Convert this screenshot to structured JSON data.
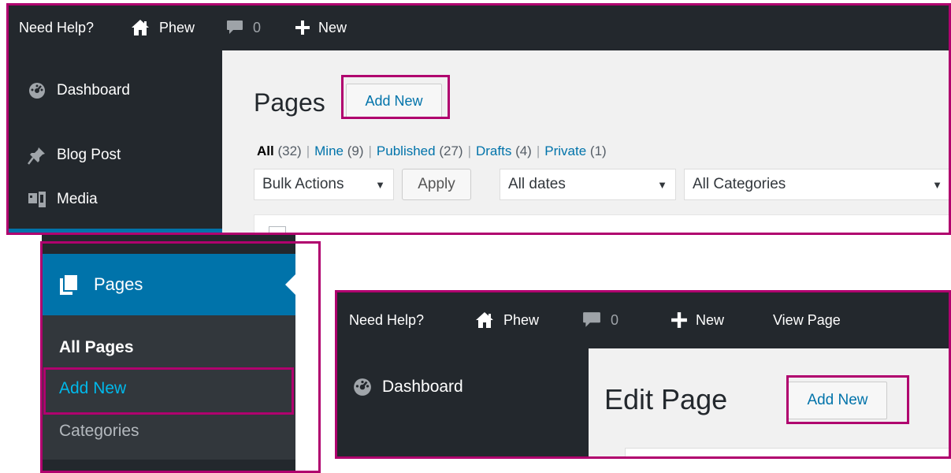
{
  "colors": {
    "admin_bar": "#23282d",
    "admin_menu": "#23282d",
    "submenu": "#32373c",
    "accent_blue": "#0073aa",
    "content_bg": "#f1f1f1",
    "highlight": "#b0006e"
  },
  "panel1": {
    "admin_bar": {
      "help": "Need Help?",
      "site": "Phew",
      "site_icon": "home-icon",
      "comments_count": "0",
      "comments_icon": "comment-bubble-icon",
      "new": "New",
      "new_icon": "plus-icon"
    },
    "sidebar": [
      {
        "label": "Dashboard",
        "icon": "dashboard-gauge-icon"
      },
      {
        "label": "Blog Post",
        "icon": "pushpin-icon"
      },
      {
        "label": "Media",
        "icon": "media-icon"
      }
    ],
    "title": "Pages",
    "add_new": "Add New",
    "filters": {
      "all": "All",
      "all_count": "(32)",
      "mine": "Mine",
      "mine_count": "(9)",
      "published": "Published",
      "published_count": "(27)",
      "drafts": "Drafts",
      "drafts_count": "(4)",
      "private": "Private",
      "private_count": "(1)"
    },
    "bulk_actions": "Bulk Actions",
    "apply": "Apply",
    "dates": "All dates",
    "categories": "All Categories"
  },
  "panel2": {
    "menu_label": "Pages",
    "menu_icon": "pages-icon",
    "submenu": [
      "All Pages",
      "Add New",
      "Categories"
    ]
  },
  "panel3": {
    "admin_bar": {
      "help": "Need Help?",
      "site": "Phew",
      "comments_count": "0",
      "new": "New",
      "view_page": "View Page"
    },
    "sidebar_item": "Dashboard",
    "title": "Edit Page",
    "add_new": "Add New"
  }
}
